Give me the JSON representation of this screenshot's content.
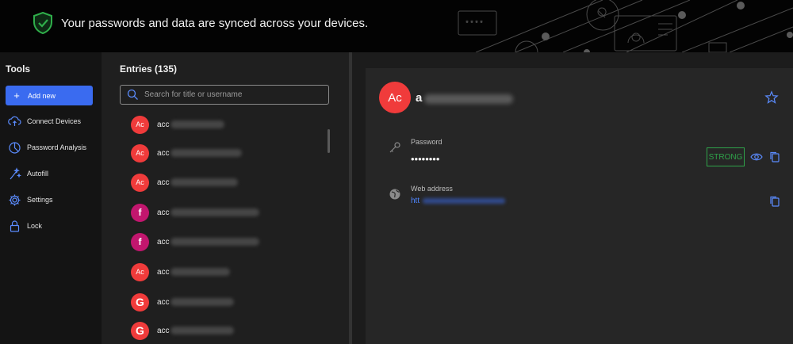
{
  "banner": {
    "message": "Your passwords and data are synced across your devices.",
    "password_mask": "****"
  },
  "tools": {
    "title": "Tools",
    "add_new": "Add new",
    "items": [
      {
        "label": "Connect Devices",
        "icon": "cloud-sync-icon"
      },
      {
        "label": "Password Analysis",
        "icon": "pie-chart-icon"
      },
      {
        "label": "Autofill",
        "icon": "magic-wand-icon"
      },
      {
        "label": "Settings",
        "icon": "gear-icon"
      },
      {
        "label": "Lock",
        "icon": "lock-icon"
      }
    ]
  },
  "entries": {
    "title": "Entries (135)",
    "search_placeholder": "Search for title or username",
    "items": [
      {
        "avatar": "Ac",
        "name": "acc",
        "color": "#f03b3b"
      },
      {
        "avatar": "Ac",
        "name": "acc",
        "color": "#f03b3b"
      },
      {
        "avatar": "Ac",
        "name": "acc",
        "color": "#f03b3b"
      },
      {
        "avatar": "f",
        "name": "acc",
        "color": "#c2166e"
      },
      {
        "avatar": "f",
        "name": "acc",
        "color": "#c2166e"
      },
      {
        "avatar": "Ac",
        "name": "acc",
        "color": "#f03b3b"
      },
      {
        "avatar": "G",
        "name": "acc",
        "color": "#f03b3b"
      },
      {
        "avatar": "G",
        "name": "acc",
        "color": "#f03b3b"
      }
    ]
  },
  "detail": {
    "avatar": "Ac",
    "title": "a",
    "password_label": "Password",
    "password_value": "••••••••",
    "strength": "STRONG",
    "web_label": "Web address",
    "web_value": "htt"
  },
  "colors": {
    "accent": "#3a6bf0",
    "avatar_red": "#f03b3b",
    "avatar_pink": "#c2166e",
    "strong_green": "#2fa34a",
    "link_blue": "#4f86ff"
  }
}
